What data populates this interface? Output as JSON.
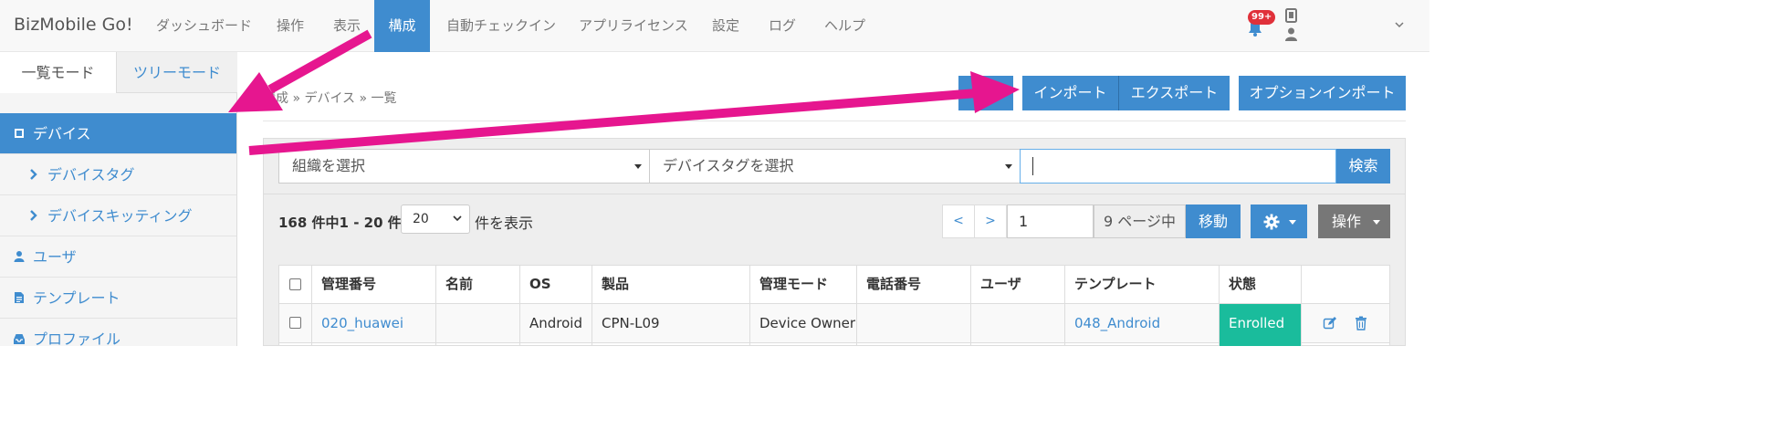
{
  "brand": "BizMobile Go!",
  "nav": [
    {
      "label": "ダッシュボード"
    },
    {
      "label": "操作"
    },
    {
      "label": "表示"
    },
    {
      "label": "構成"
    },
    {
      "label": "自動チェックイン"
    },
    {
      "label": "アプリライセンス"
    },
    {
      "label": "設定"
    },
    {
      "label": "ログ"
    },
    {
      "label": "ヘルプ"
    }
  ],
  "nav_active": "構成",
  "notifications": {
    "badge": "99+"
  },
  "mode_tabs": {
    "list": "一覧モード",
    "tree": "ツリーモード"
  },
  "sidebar": {
    "items": [
      {
        "label": "デバイス",
        "icon": "square-icon"
      },
      {
        "label": "デバイスタグ",
        "icon": "chevron-right-icon"
      },
      {
        "label": "デバイスキッティング",
        "icon": "chevron-right-icon"
      },
      {
        "label": "ユーザ",
        "icon": "user-icon"
      },
      {
        "label": "テンプレート",
        "icon": "file-icon"
      },
      {
        "label": "プロファイル",
        "icon": "inbox-icon"
      }
    ]
  },
  "breadcrumb": "構成 » デバイス » 一覧",
  "toolbar": {
    "import": "インポート",
    "export": "エクスポート",
    "option_import": "オプションインポート"
  },
  "filters": {
    "org_placeholder": "組織を選択",
    "tag_placeholder": "デバイスタグを選択",
    "search_value": "",
    "search_button": "検索"
  },
  "listing": {
    "count_text": "168 件中1 - 20 件",
    "per_page": "20",
    "per_page_suffix": "件を表示"
  },
  "pagination": {
    "prev": "<",
    "next": ">",
    "page": "1",
    "total_pages_text": "9 ページ中",
    "move": "移動",
    "operations": "操作"
  },
  "table": {
    "columns": [
      "管理番号",
      "名前",
      "OS",
      "製品",
      "管理モード",
      "電話番号",
      "ユーザ",
      "テンプレート",
      "状態"
    ],
    "rows": [
      {
        "id": "020_huawei",
        "name": "",
        "os": "Android",
        "product": "CPN-L09",
        "mode": "Device Owner",
        "phone": "",
        "user": "",
        "template": "048_Android",
        "status": "Enrolled"
      }
    ]
  },
  "colors": {
    "primary": "#3f8ccf",
    "enrolled": "#1abc9c",
    "annotation_arrow": "#e6168f",
    "ops_button": "#777777"
  }
}
